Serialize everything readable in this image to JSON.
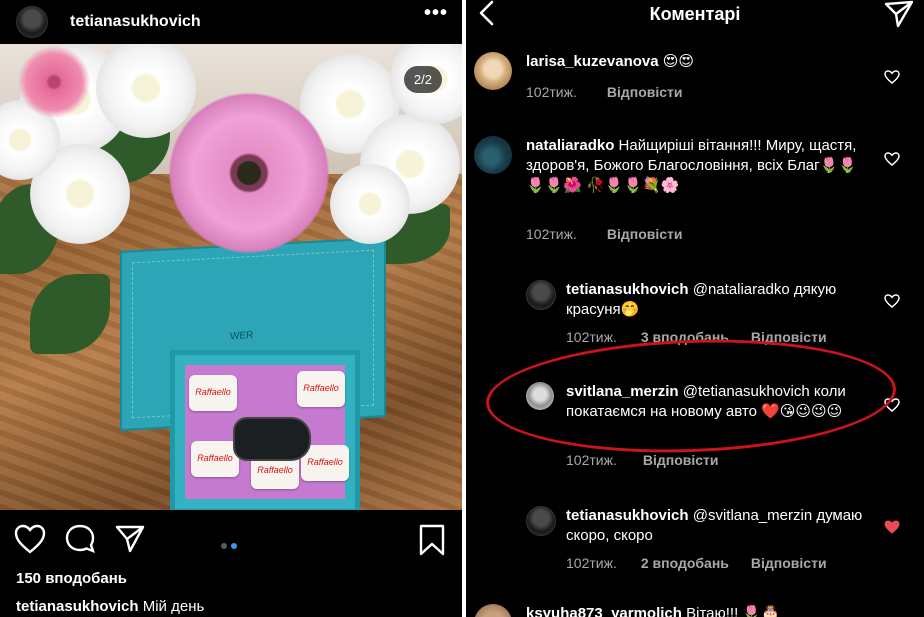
{
  "left": {
    "username": "tetianasukhovich",
    "pager": "2/2",
    "likes": "150 вподобань",
    "caption_user": "tetianasukhovich",
    "caption_text": "Мій день",
    "box_label": "WER",
    "candy_label": "Raffaello",
    "page_dots_colors": [
      "#5a5a5a",
      "#3897f0"
    ]
  },
  "right": {
    "title": "Коментарі",
    "comments": [
      {
        "user": "larisa_kuzevanova",
        "text": "😍😍",
        "time": "102тиж.",
        "reply": "Відповісти",
        "likes": "",
        "liked": false
      },
      {
        "user": "nataliaradko",
        "text": "Найщиріші вітання!!! Миру, щастя, здоров'я, Божого Благословіння, всіх Благ🌷🌷🌷🌷🌺 🥀🌷🌷💐🌸",
        "time": "102тиж.",
        "reply": "Відповісти",
        "likes": "",
        "liked": false
      },
      {
        "user": "tetianasukhovich",
        "text": "@nataliaradko дякую красуня🤭",
        "time": "102тиж.",
        "reply": "Відповісти",
        "likes": "3 вподобань",
        "liked": false
      },
      {
        "user": "svitlana_merzin",
        "text": "@tetianasukhovich коли покатаємся на новому авто ❤️😘😉😉😉",
        "time": "102тиж.",
        "reply": "Відповісти",
        "likes": "",
        "liked": false
      },
      {
        "user": "tetianasukhovich",
        "text": "@svitlana_merzin думаю скоро, скоро",
        "time": "102тиж.",
        "reply": "Відповісти",
        "likes": "2 вподобань",
        "liked": true
      },
      {
        "user": "ksyuha873_yarmolich",
        "text": "Вітаю!!! 🌷🎂",
        "time": "",
        "reply": "",
        "likes": "",
        "liked": false
      }
    ],
    "highlight_color": "#c8141a",
    "liked_heart_color": "#ed4956"
  }
}
